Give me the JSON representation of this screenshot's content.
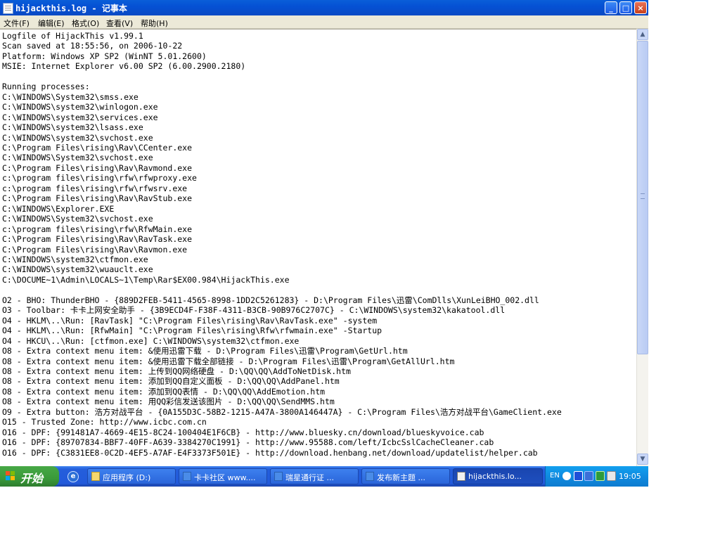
{
  "window": {
    "title": "hijackthis.log - 记事本",
    "minimize": "_",
    "maximize": "□",
    "close": "×"
  },
  "menu": [
    {
      "label": "文件(F)"
    },
    {
      "label": "编辑(E)"
    },
    {
      "label": "格式(O)"
    },
    {
      "label": "查看(V)"
    },
    {
      "label": "帮助(H)"
    }
  ],
  "editor": {
    "content": "Logfile of HijackThis v1.99.1\nScan saved at 18:55:56, on 2006-10-22\nPlatform: Windows XP SP2 (WinNT 5.01.2600)\nMSIE: Internet Explorer v6.00 SP2 (6.00.2900.2180)\n\nRunning processes:\nC:\\WINDOWS\\System32\\smss.exe\nC:\\WINDOWS\\system32\\winlogon.exe\nC:\\WINDOWS\\system32\\services.exe\nC:\\WINDOWS\\system32\\lsass.exe\nC:\\WINDOWS\\system32\\svchost.exe\nC:\\Program Files\\rising\\Rav\\CCenter.exe\nC:\\WINDOWS\\System32\\svchost.exe\nC:\\Program Files\\rising\\Rav\\Ravmond.exe\nc:\\program files\\rising\\rfw\\rfwproxy.exe\nc:\\program files\\rising\\rfw\\rfwsrv.exe\nC:\\Program Files\\rising\\Rav\\RavStub.exe\nC:\\WINDOWS\\Explorer.EXE\nC:\\WINDOWS\\System32\\svchost.exe\nc:\\program files\\rising\\rfw\\RfwMain.exe\nC:\\Program Files\\rising\\Rav\\RavTask.exe\nC:\\Program Files\\rising\\Rav\\Ravmon.exe\nC:\\WINDOWS\\system32\\ctfmon.exe\nC:\\WINDOWS\\system32\\wuauclt.exe\nC:\\DOCUME~1\\Admin\\LOCALS~1\\Temp\\Rar$EX00.984\\HijackThis.exe\n\nO2 - BHO: ThunderBHO - {889D2FEB-5411-4565-8998-1DD2C5261283} - D:\\Program Files\\迅雷\\ComDlls\\XunLeiBHO_002.dll\nO3 - Toolbar: 卡卡上网安全助手 - {3B9ECD4F-F38F-4311-B3CB-90B976C2707C} - C:\\WINDOWS\\system32\\kakatool.dll\nO4 - HKLM\\..\\Run: [RavTask] \"C:\\Program Files\\rising\\Rav\\RavTask.exe\" -system\nO4 - HKLM\\..\\Run: [RfwMain] \"C:\\Program Files\\rising\\Rfw\\rfwmain.exe\" -Startup\nO4 - HKCU\\..\\Run: [ctfmon.exe] C:\\WINDOWS\\system32\\ctfmon.exe\nO8 - Extra context menu item: &使用迅雷下载 - D:\\Program Files\\迅雷\\Program\\GetUrl.htm\nO8 - Extra context menu item: &使用迅雷下载全部链接 - D:\\Program Files\\迅雷\\Program\\GetAllUrl.htm\nO8 - Extra context menu item: 上传到QQ网络硬盘 - D:\\QQ\\QQ\\AddToNetDisk.htm\nO8 - Extra context menu item: 添加到QQ自定义面板 - D:\\QQ\\QQ\\AddPanel.htm\nO8 - Extra context menu item: 添加到QQ表情 - D:\\QQ\\QQ\\AddEmotion.htm\nO8 - Extra context menu item: 用QQ彩信发送该图片 - D:\\QQ\\QQ\\SendMMS.htm\nO9 - Extra button: 浩方对战平台 - {0A155D3C-58B2-1215-A47A-3800A146447A} - C:\\Program Files\\浩方对战平台\\GameClient.exe\nO15 - Trusted Zone: http://www.icbc.com.cn\nO16 - DPF: {991481A7-4669-4E15-8C24-100404E1F6CB} - http://www.bluesky.cn/download/blueskyvoice.cab\nO16 - DPF: {89707834-BBF7-40FF-A639-3384270C1991} - http://www.95588.com/left/IcbcSslCacheCleaner.cab\nO16 - DPF: {C3831EE8-0C2D-4EF5-A7AF-E4F3373F501E} - http://download.henbang.net/download/updatelist/helper.cab"
  },
  "taskbar": {
    "start_label": "开始",
    "tasks": [
      {
        "label": "应用程序 (D:)"
      },
      {
        "label": "卡卡社区 www...."
      },
      {
        "label": "瑞星通行证   ..."
      },
      {
        "label": "发布新主题   ..."
      },
      {
        "label": "hijackthis.lo..."
      }
    ],
    "tray": {
      "lang": "EN",
      "clock": "19:05"
    }
  }
}
